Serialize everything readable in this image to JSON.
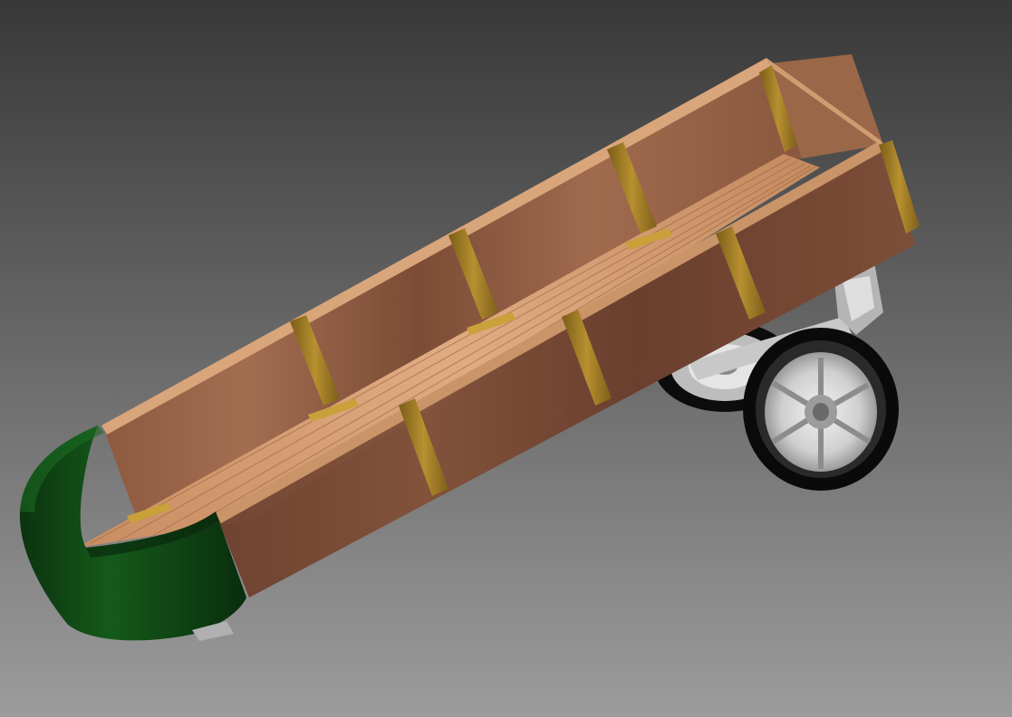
{
  "scene": {
    "subject": "wooden-cart-3d-render",
    "colors": {
      "background_top": "#3a3a3a",
      "background_bottom": "#9a9a9a",
      "wood_light": "#d29a6c",
      "wood_dark": "#7a4a34",
      "bracket": "#b08a2a",
      "front_panel": "#0e3d12",
      "tire": "#0a0a0a",
      "rim": "#d8d8d8"
    }
  }
}
